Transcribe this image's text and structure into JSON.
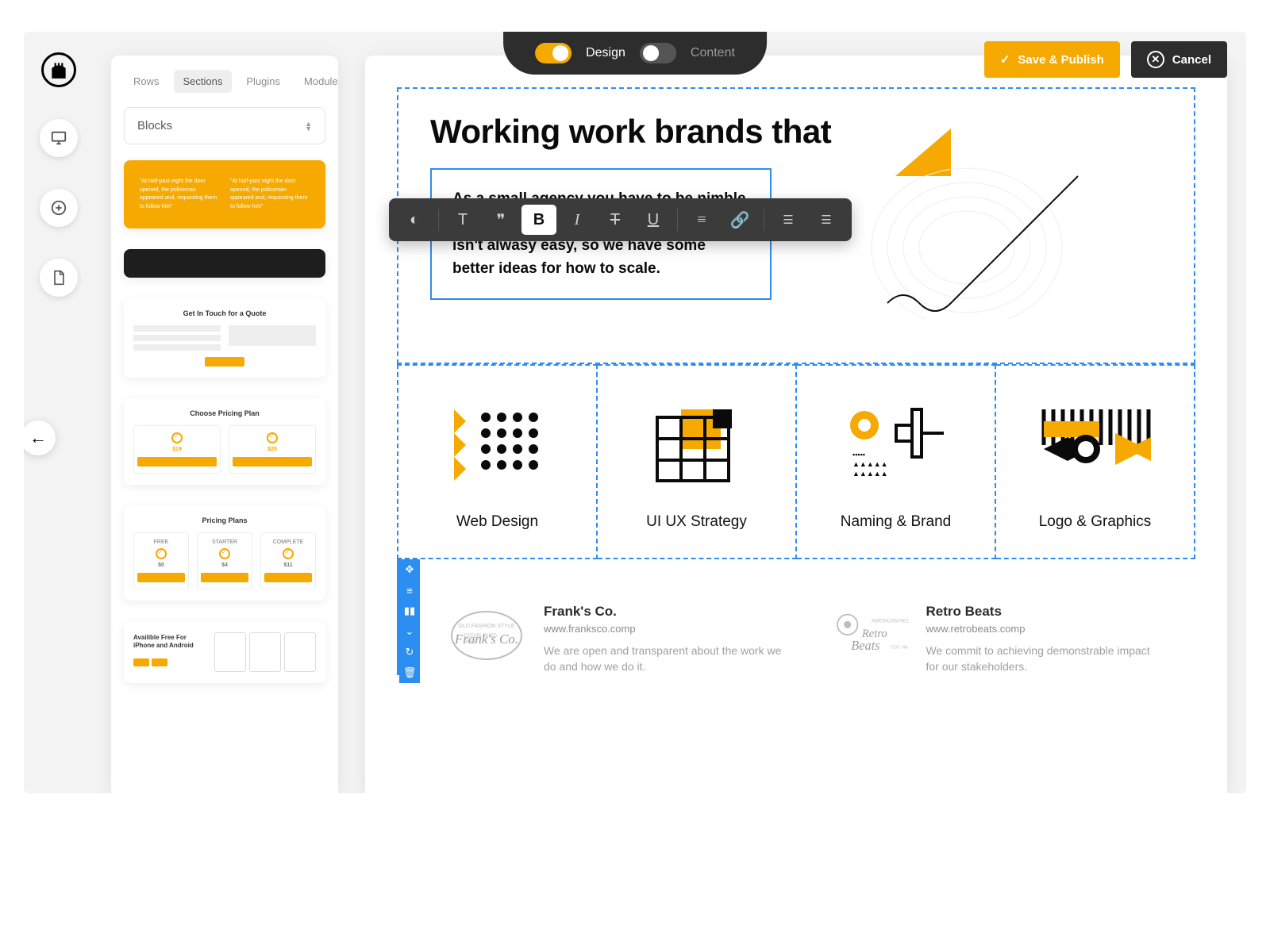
{
  "mode": {
    "design_label": "Design",
    "content_label": "Content"
  },
  "actions": {
    "save_label": "Save & Publish",
    "cancel_label": "Cancel"
  },
  "sidebar": {
    "tabs": [
      "Rows",
      "Sections",
      "Plugins",
      "Modules"
    ],
    "active_tab": 1,
    "select_label": "Blocks",
    "thumbs": {
      "quote_text": "\"At half-past eight the door opened, the policeman appeared and, requesting them to follow him\"",
      "t1_title": "Get In Touch for a Quote",
      "t2_title": "Choose Pricing Plan",
      "t3_title": "Pricing Plans",
      "t3_cols": [
        "FREE",
        "STARTER",
        "COMPLETE"
      ],
      "t3_prices": [
        "$0",
        "$4",
        "$11"
      ],
      "t4_title": "Availible Free For iPhone and Android"
    }
  },
  "hero": {
    "title": "Working work brands that",
    "paragraph": "As a small agency you have to be nimble and represent the common good. This isn't alwasy easy, so we have some better ideas for how to scale."
  },
  "services": [
    {
      "title": "Web Design"
    },
    {
      "title": "UI UX Strategy"
    },
    {
      "title": "Naming & Brand"
    },
    {
      "title": "Logo & Graphics"
    }
  ],
  "clients": [
    {
      "name": "Frank's Co.",
      "url": "www.franksco.comp",
      "desc": "We are open and transparent about the work we do and how we do it."
    },
    {
      "name": "Retro Beats",
      "url": "www.retrobeats.comp",
      "desc": "We commit to achieving demonstrable impact for our stakeholders."
    }
  ]
}
